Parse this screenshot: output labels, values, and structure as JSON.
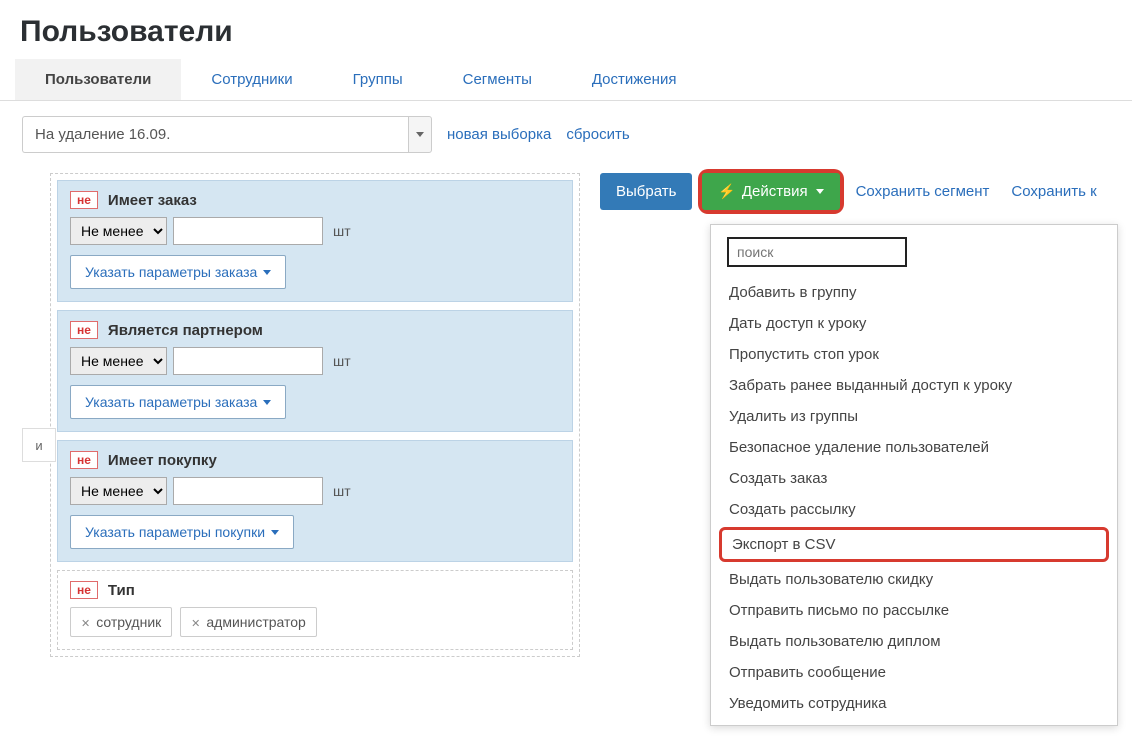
{
  "page_title": "Пользователи",
  "tabs": [
    {
      "label": "Пользователи",
      "active": true
    },
    {
      "label": "Сотрудники",
      "active": false
    },
    {
      "label": "Группы",
      "active": false
    },
    {
      "label": "Сегменты",
      "active": false
    },
    {
      "label": "Достижения",
      "active": false
    }
  ],
  "filter_preset": "На удаление 16.09.",
  "links": {
    "new_selection": "новая выборка",
    "reset": "сбросить"
  },
  "and_label": "и",
  "neg_label": "не",
  "unit_pcs": "шт",
  "comparator": "Не менее",
  "filter_cards": [
    {
      "title": "Имеет заказ",
      "param_btn": "Указать параметры заказа",
      "has_inputs": true
    },
    {
      "title": "Является партнером",
      "param_btn": "Указать параметры заказа",
      "has_inputs": true
    },
    {
      "title": "Имеет покупку",
      "param_btn": "Указать параметры покупки",
      "has_inputs": true
    }
  ],
  "type_card": {
    "title": "Тип",
    "tags": [
      "сотрудник",
      "администратор"
    ]
  },
  "toolbar": {
    "select_btn": "Выбрать",
    "actions_btn": "Действия",
    "save_segment": "Сохранить сегмент",
    "save_as": "Сохранить к"
  },
  "dropdown": {
    "search_placeholder": "поиск",
    "items": [
      "Добавить в группу",
      "Дать доступ к уроку",
      "Пропустить стоп урок",
      "Забрать ранее выданный доступ к уроку",
      "Удалить из группы",
      "Безопасное удаление пользователей",
      "Создать заказ",
      "Создать рассылку",
      "Экспорт в CSV",
      "Выдать пользователю скидку",
      "Отправить письмо по рассылке",
      "Выдать пользователю диплом",
      "Отправить сообщение",
      "Уведомить сотрудника"
    ],
    "highlighted_index": 8
  }
}
